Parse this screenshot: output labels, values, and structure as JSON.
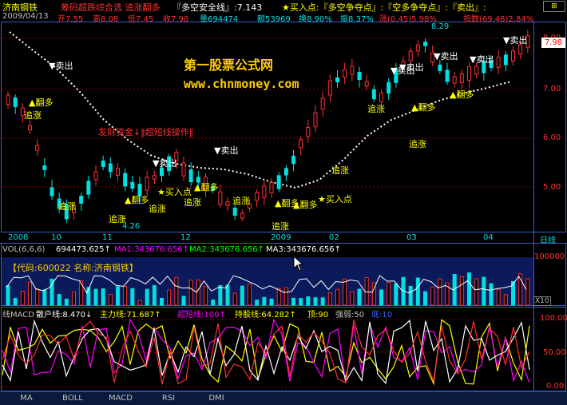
{
  "header": {
    "stock_name": "济南钢铁",
    "indicator_title": "筹码超跌综合选 追涨翻多",
    "safety_line": "『多空安全线』:7.143",
    "buy_point": "★买入点:『多空争夺点』:『空多争夺点』:『卖出』:",
    "date": "2009/04/13",
    "open": "开7.55",
    "high": "高8.08",
    "low": "低7.45",
    "close": "收7.98",
    "volume": "量694474",
    "amount": "额53969",
    "turnover": "换8.90%",
    "amplitude": "振8.37%",
    "change": "涨(0.45)5.98%",
    "index": "指数(69.48)2.84%"
  },
  "main_chart": {
    "price_axis": [
      "8.00",
      "7.00",
      "6.00",
      "5.00"
    ],
    "current_price": "7.98",
    "high_label": "8.29",
    "low_label": "4.26",
    "watermark_title": "第一股票公式网",
    "watermark_url": "www.chnmoney.com",
    "watermark_note": "发财资金↓‖超短线操作‖",
    "signals": {
      "sell": "卖出",
      "flip_long": "翻多",
      "chase": "追涨",
      "buy": "买入点"
    }
  },
  "date_axis": [
    "2008",
    "10",
    "11",
    "12",
    "2009",
    "02",
    "03",
    "04"
  ],
  "period_label": "日线",
  "volume_panel": {
    "title": "VOL(6,6,6)",
    "vol": "694473.625↑",
    "ma1": "MA1:343676.656↑",
    "ma2": "MA2:343676.656↑",
    "ma3": "MA3:343676.656↑",
    "code_line": "【代码:600022 名称:济南钢铁】",
    "axis_top": "100000",
    "axis_unit": "X10"
  },
  "indicator_panel": {
    "name": "线MACD",
    "retail": "散户线:8.470↓",
    "main_force": "主力线:71.687↑",
    "ultra_short": "超短线:100↑",
    "holding": "持股线:64.282↑",
    "top": "顶:90",
    "strong_weak": "强弱:50",
    "low": "底:10",
    "axis": [
      "100.00",
      "50.00",
      "0.00"
    ]
  },
  "tabs": [
    "MA",
    "BOLL",
    "MACD",
    "RSI",
    "DMI"
  ],
  "colors": {
    "up": "#ff3030",
    "down": "#00e0e0",
    "grid": "#8b0000",
    "frame": "#3a5bd0",
    "yellow": "#ffff00",
    "magenta": "#ff00ff",
    "white": "#ffffff"
  }
}
